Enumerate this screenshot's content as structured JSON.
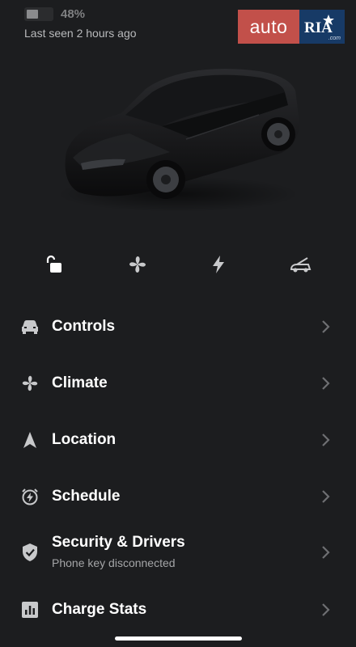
{
  "status": {
    "battery_percent_text": "48%",
    "battery_level": 0.48,
    "last_seen": "Last seen 2 hours ago"
  },
  "logo": {
    "auto_text": "auto",
    "ria_text": "RIA",
    "com_text": ".com",
    "auto_color": "#c2504a",
    "ria_color": "#173a66"
  },
  "quick_actions": [
    {
      "name": "unlock",
      "icon": "unlocked-padlock-icon"
    },
    {
      "name": "climate",
      "icon": "fan-icon"
    },
    {
      "name": "charge",
      "icon": "lightning-bolt-icon"
    },
    {
      "name": "frunk",
      "icon": "open-frunk-icon"
    }
  ],
  "menu": {
    "controls": {
      "label": "Controls",
      "icon": "car-icon"
    },
    "climate": {
      "label": "Climate",
      "icon": "fan-icon"
    },
    "location": {
      "label": "Location",
      "icon": "navigation-arrow-icon"
    },
    "schedule": {
      "label": "Schedule",
      "icon": "alarm-clock-icon"
    },
    "security": {
      "label": "Security & Drivers",
      "sublabel": "Phone key disconnected",
      "icon": "shield-check-icon"
    },
    "charge_stats": {
      "label": "Charge Stats",
      "icon": "bar-chart-icon"
    }
  },
  "colors": {
    "background": "#1c1d1f",
    "text": "#ffffff",
    "muted": "#a4a5a7",
    "icon": "#c8c9cb"
  }
}
